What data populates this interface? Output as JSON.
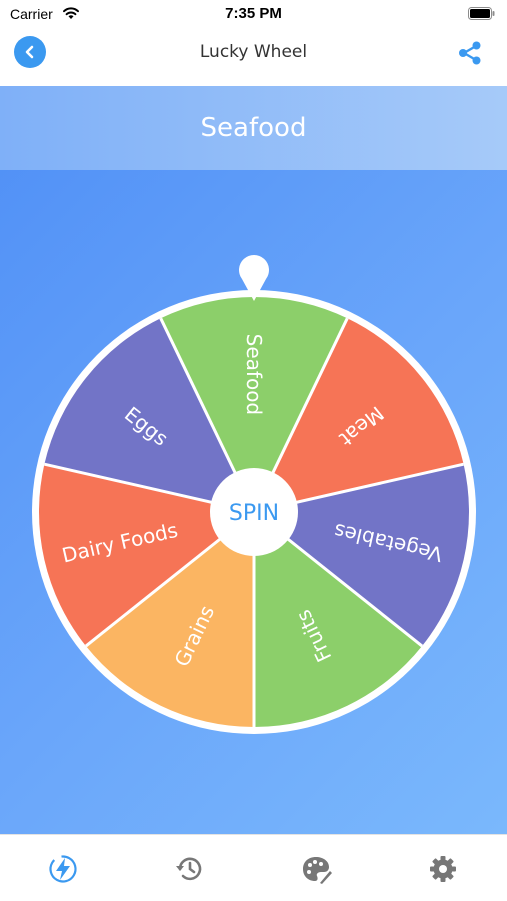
{
  "status_bar": {
    "carrier": "Carrier",
    "time": "7:35 PM"
  },
  "nav": {
    "title": "Lucky Wheel"
  },
  "result": {
    "text": "Seafood"
  },
  "wheel": {
    "center_label": "SPIN",
    "segments": [
      {
        "label": "Seafood",
        "color": "#8ccf6a"
      },
      {
        "label": "Meat",
        "color": "#f67456"
      },
      {
        "label": "Vegetables",
        "color": "#7274c7"
      },
      {
        "label": "Fruits",
        "color": "#8ccf6a"
      },
      {
        "label": "Grains",
        "color": "#fbb562"
      },
      {
        "label": "Dairy Foods",
        "color": "#f67456"
      },
      {
        "label": "Eggs",
        "color": "#7274c7"
      }
    ]
  },
  "tabs": [
    {
      "name": "spin",
      "icon": "lightning-icon",
      "active": true
    },
    {
      "name": "history",
      "icon": "history-icon",
      "active": false
    },
    {
      "name": "themes",
      "icon": "palette-icon",
      "active": false
    },
    {
      "name": "settings",
      "icon": "gear-icon",
      "active": false
    }
  ],
  "colors": {
    "accent": "#3b99f0",
    "inactive": "#777777",
    "wheel_rim": "#ffffff"
  }
}
